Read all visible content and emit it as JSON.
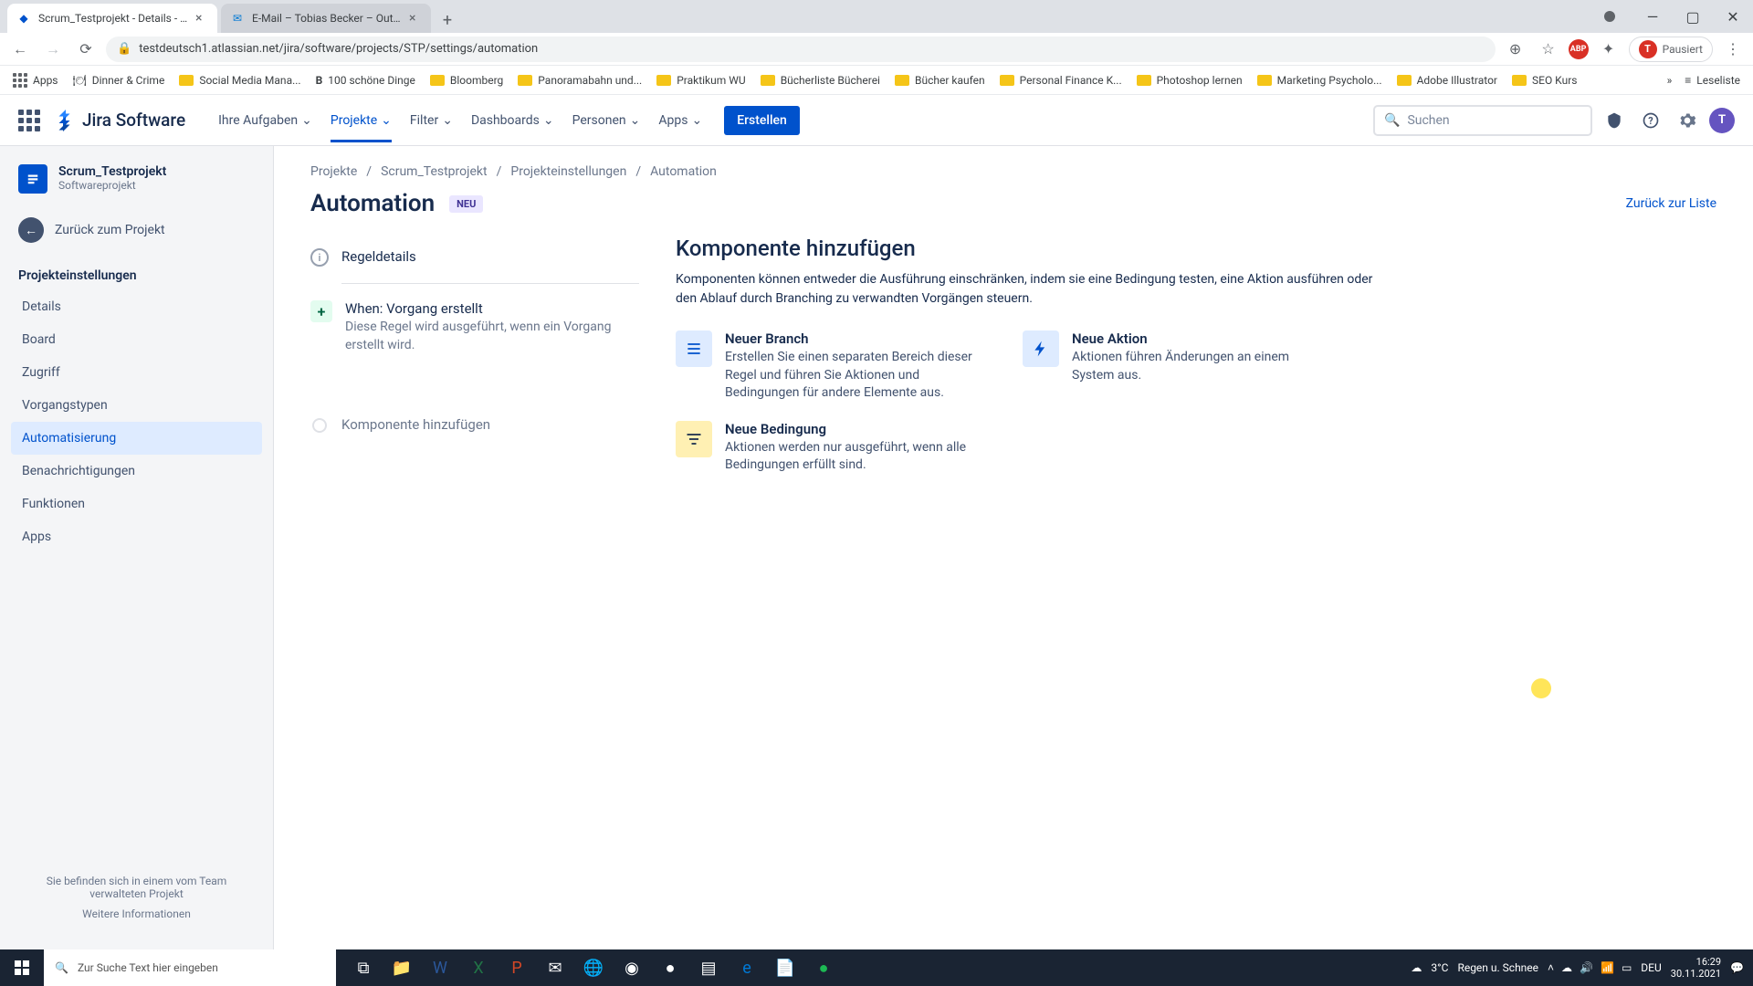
{
  "browser": {
    "tabs": [
      {
        "title": "Scrum_Testprojekt - Details - Jira",
        "active": true
      },
      {
        "title": "E-Mail – Tobias Becker – Outlook",
        "active": false
      }
    ],
    "url": "testdeutsch1.atlassian.net/jira/software/projects/STP/settings/automation",
    "profile_label": "Pausiert",
    "bookmarks": [
      "Apps",
      "Dinner & Crime",
      "Social Media Mana...",
      "100 schöne Dinge",
      "Bloomberg",
      "Panoramabahn und...",
      "Praktikum WU",
      "Bücherliste Bücherei",
      "Bücher kaufen",
      "Personal Finance K...",
      "Photoshop lernen",
      "Marketing Psycholo...",
      "Adobe Illustrator",
      "SEO Kurs"
    ],
    "readlist": "Leseliste"
  },
  "jira": {
    "logo_text": "Jira Software",
    "nav": {
      "items": [
        "Ihre Aufgaben",
        "Projekte",
        "Filter",
        "Dashboards",
        "Personen",
        "Apps"
      ],
      "active": 1
    },
    "create": "Erstellen",
    "search_placeholder": "Suchen",
    "avatar_initial": "T"
  },
  "sidebar": {
    "project": {
      "name": "Scrum_Testprojekt",
      "type": "Softwareprojekt"
    },
    "back": "Zurück zum Projekt",
    "section": "Projekteinstellungen",
    "items": [
      "Details",
      "Board",
      "Zugriff",
      "Vorgangstypen",
      "Automatisierung",
      "Benachrichtigungen",
      "Funktionen",
      "Apps"
    ],
    "active": 4,
    "footer": "Sie befinden sich in einem vom Team verwalteten Projekt",
    "footer_link": "Weitere Informationen"
  },
  "main": {
    "breadcrumbs": [
      "Projekte",
      "Scrum_Testprojekt",
      "Projekteinstellungen",
      "Automation"
    ],
    "title": "Automation",
    "badge": "NEU",
    "back_list": "Zurück zur Liste",
    "rules": [
      {
        "kind": "info",
        "title": "Regeldetails"
      },
      {
        "kind": "trigger",
        "title": "When: Vorgang erstellt",
        "desc": "Diese Regel wird ausgeführt, wenn ein Vorgang erstellt wird."
      },
      {
        "kind": "add",
        "title": "Komponente hinzufügen"
      }
    ],
    "panel": {
      "title": "Komponente hinzufügen",
      "desc": "Komponenten können entweder die Ausführung einschränken, indem sie eine Bedingung testen, eine Aktion ausführen oder den Ablauf durch Branching zu verwandten Vorgängen steuern.",
      "options": [
        {
          "icon": "branch",
          "title": "Neuer Branch",
          "desc": "Erstellen Sie einen separaten Bereich dieser Regel und führen Sie Aktionen und Bedingungen für andere Elemente aus."
        },
        {
          "icon": "action",
          "title": "Neue Aktion",
          "desc": "Aktionen führen Änderungen an einem System aus."
        },
        {
          "icon": "cond",
          "title": "Neue Bedingung",
          "desc": "Aktionen werden nur ausgeführt, wenn alle Bedingungen erfüllt sind."
        }
      ]
    }
  },
  "taskbar": {
    "search_placeholder": "Zur Suche Text hier eingeben",
    "weather_temp": "3°C",
    "weather_desc": "Regen u. Schnee",
    "lang": "DEU",
    "time": "16:29",
    "date": "30.11.2021"
  }
}
